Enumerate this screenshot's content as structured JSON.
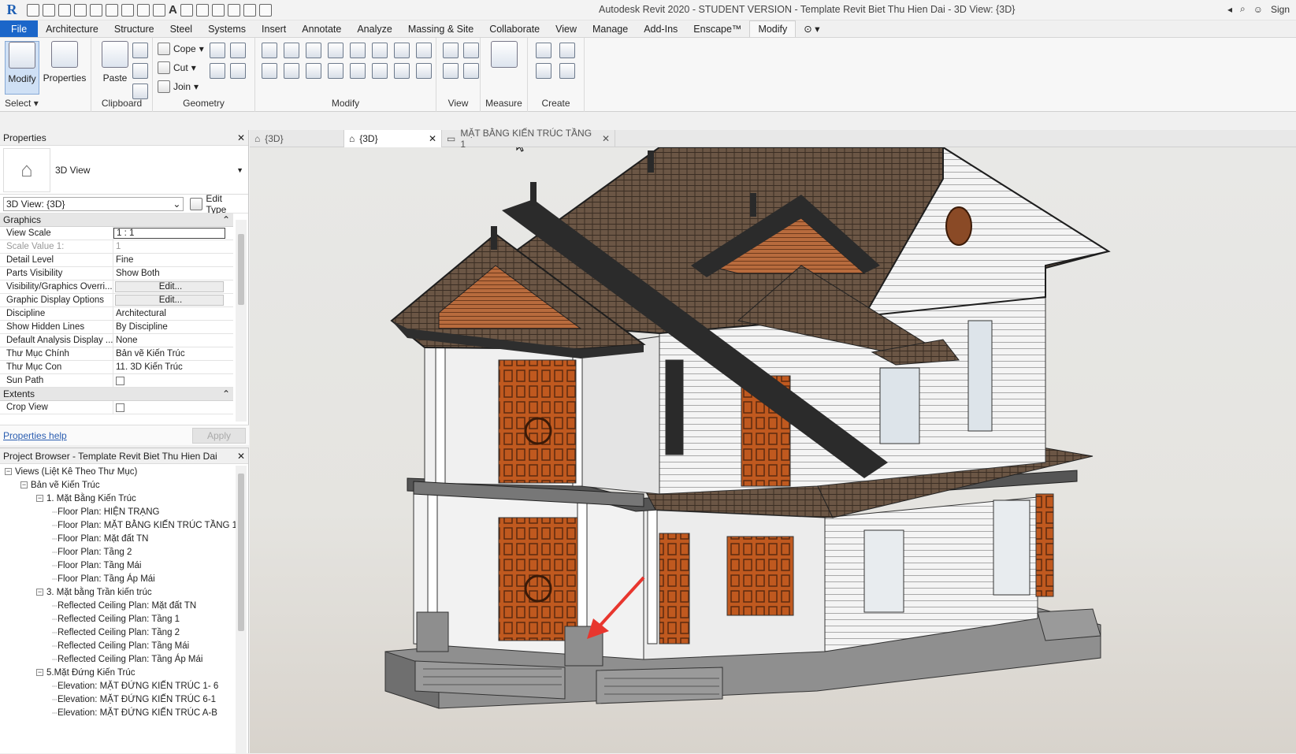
{
  "window_title": "Autodesk Revit 2020 - STUDENT VERSION - Template Revit Biet Thu Hien Dai - 3D View: {3D}",
  "user_label": "Sign",
  "menu_tabs": [
    "File",
    "Architecture",
    "Structure",
    "Steel",
    "Systems",
    "Insert",
    "Annotate",
    "Analyze",
    "Massing & Site",
    "Collaborate",
    "View",
    "Manage",
    "Add-Ins",
    "Enscape™",
    "Modify"
  ],
  "active_menu_tab": "Modify",
  "ribbon": {
    "select": {
      "modify_label": "Modify",
      "properties_label": "Properties",
      "panel_label": "Select"
    },
    "clipboard": {
      "paste_label": "Paste",
      "panel_label": "Clipboard"
    },
    "geometry": {
      "cope_label": "Cope",
      "cut_label": "Cut",
      "join_label": "Join",
      "panel_label": "Geometry"
    },
    "modify": {
      "panel_label": "Modify"
    },
    "view": {
      "panel_label": "View"
    },
    "measure": {
      "panel_label": "Measure"
    },
    "create": {
      "panel_label": "Create"
    }
  },
  "properties": {
    "title": "Properties",
    "type_name": "3D View",
    "instance_selector": "3D View: {3D}",
    "edit_type_label": "Edit Type",
    "groups": {
      "graphics": "Graphics",
      "extents": "Extents"
    },
    "rows": [
      {
        "name": "View Scale",
        "value": "1 : 1"
      },
      {
        "name": "Scale Value    1:",
        "value": "1"
      },
      {
        "name": "Detail Level",
        "value": "Fine"
      },
      {
        "name": "Parts Visibility",
        "value": "Show Both"
      },
      {
        "name": "Visibility/Graphics Overri...",
        "value": "Edit..."
      },
      {
        "name": "Graphic Display Options",
        "value": "Edit..."
      },
      {
        "name": "Discipline",
        "value": "Architectural"
      },
      {
        "name": "Show Hidden Lines",
        "value": "By Discipline"
      },
      {
        "name": "Default Analysis Display ...",
        "value": "None"
      },
      {
        "name": "Thư Mục Chính",
        "value": "Bản vẽ Kiến Trúc"
      },
      {
        "name": "Thư Mục Con",
        "value": "11. 3D Kiến Trúc"
      },
      {
        "name": "Sun Path",
        "value": ""
      },
      {
        "name": "Crop View",
        "value": ""
      }
    ],
    "help_link": "Properties help",
    "apply_label": "Apply"
  },
  "browser": {
    "title": "Project Browser - Template Revit Biet Thu Hien Dai",
    "items": [
      {
        "label": "Views (Liệt Kê Theo Thư Mục)",
        "level": 0,
        "toggle": "−"
      },
      {
        "label": "Bản vẽ Kiến Trúc",
        "level": 1,
        "toggle": "−"
      },
      {
        "label": "1. Mặt Bằng Kiến Trúc",
        "level": 2,
        "toggle": "−"
      },
      {
        "label": "Floor Plan: HIỆN TRẠNG",
        "level": 3,
        "toggle": ""
      },
      {
        "label": "Floor Plan: MẶT BẰNG KIẾN TRÚC TẦNG 1",
        "level": 3,
        "toggle": ""
      },
      {
        "label": "Floor Plan: Mặt đất TN",
        "level": 3,
        "toggle": ""
      },
      {
        "label": "Floor Plan: Tầng 2",
        "level": 3,
        "toggle": ""
      },
      {
        "label": "Floor Plan: Tầng Mái",
        "level": 3,
        "toggle": ""
      },
      {
        "label": "Floor Plan: Tầng Áp Mái",
        "level": 3,
        "toggle": ""
      },
      {
        "label": "3. Mặt bằng Trần kiến trúc",
        "level": 2,
        "toggle": "−"
      },
      {
        "label": "Reflected Ceiling Plan: Mặt đất TN",
        "level": 3,
        "toggle": ""
      },
      {
        "label": "Reflected Ceiling Plan: Tầng 1",
        "level": 3,
        "toggle": ""
      },
      {
        "label": "Reflected Ceiling Plan: Tầng 2",
        "level": 3,
        "toggle": ""
      },
      {
        "label": "Reflected Ceiling Plan: Tầng Mái",
        "level": 3,
        "toggle": ""
      },
      {
        "label": "Reflected Ceiling Plan: Tầng Áp Mái",
        "level": 3,
        "toggle": ""
      },
      {
        "label": "5.Mặt Đứng Kiến Trúc",
        "level": 2,
        "toggle": "−"
      },
      {
        "label": "Elevation: MẶT ĐỨNG KIẾN TRÚC 1- 6",
        "level": 3,
        "toggle": ""
      },
      {
        "label": "Elevation: MẶT ĐỨNG KIẾN TRÚC 6-1",
        "level": 3,
        "toggle": ""
      },
      {
        "label": "Elevation: MẶT ĐỨNG KIẾN TRÚC A-B",
        "level": 3,
        "toggle": ""
      }
    ]
  },
  "view_tabs": [
    {
      "label": "{3D}",
      "active": false,
      "closable": false
    },
    {
      "label": "{3D}",
      "active": true,
      "closable": true
    },
    {
      "label": "MẶT BẰNG KIẾN TRÚC TẦNG 1",
      "active": false,
      "closable": true
    }
  ],
  "colors": {
    "accent": "#1b66c9",
    "roof": "#5a4636",
    "door": "#c15a20",
    "wall": "#f2f2f2",
    "arrow": "#e8362e"
  }
}
